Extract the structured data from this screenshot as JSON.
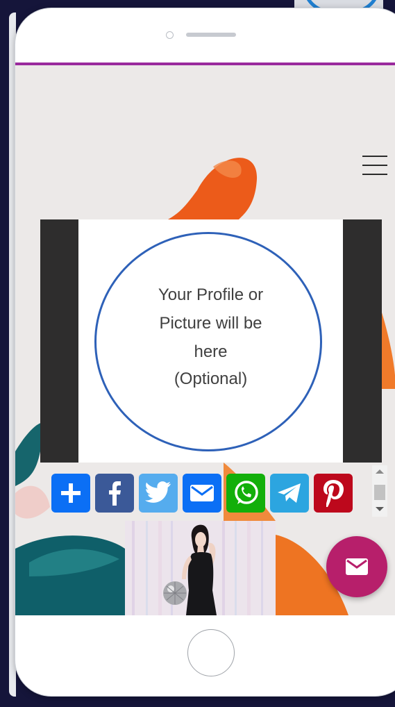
{
  "profile": {
    "placeholder_line1": "Your Profile or",
    "placeholder_line2": "Picture will be",
    "placeholder_line3": "here",
    "optional_label": "(Optional)"
  },
  "share_buttons": [
    {
      "name": "add",
      "icon": "plus-icon",
      "color": "#0b6ff5"
    },
    {
      "name": "facebook",
      "icon": "facebook-icon",
      "color": "#3b5998"
    },
    {
      "name": "twitter",
      "icon": "twitter-icon",
      "color": "#55acee"
    },
    {
      "name": "email",
      "icon": "mail-icon",
      "color": "#0b6ff5"
    },
    {
      "name": "whatsapp",
      "icon": "whatsapp-icon",
      "color": "#12af0a"
    },
    {
      "name": "telegram",
      "icon": "telegram-icon",
      "color": "#2ca5e0"
    },
    {
      "name": "pinterest",
      "icon": "pinterest-icon",
      "color": "#bd081c"
    }
  ],
  "colors": {
    "accent_bar": "#9a2a9d",
    "profile_ring": "#2e61b8",
    "mail_fab": "#b71f6b",
    "screen_bg": "#ece9e8"
  },
  "icons": {
    "menu": "hamburger-menu-icon",
    "mail_fab": "envelope-icon"
  }
}
